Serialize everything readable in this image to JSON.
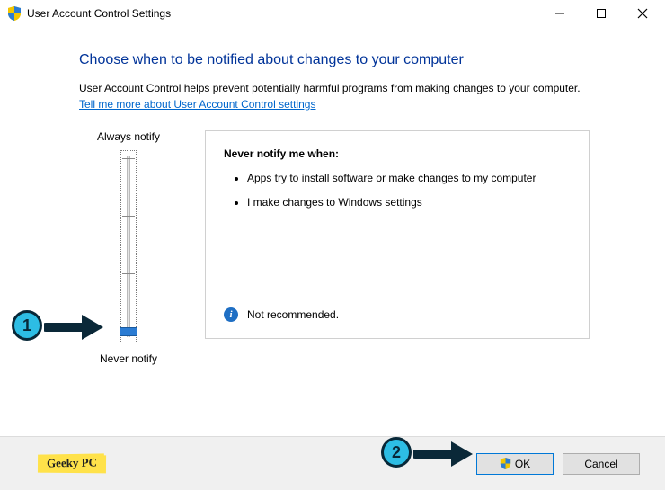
{
  "window": {
    "title": "User Account Control Settings"
  },
  "heading": "Choose when to be notified about changes to your computer",
  "subtext": "User Account Control helps prevent potentially harmful programs from making changes to your computer.",
  "helplink": "Tell me more about User Account Control settings",
  "slider": {
    "top_label": "Always notify",
    "bottom_label": "Never notify"
  },
  "panel": {
    "title": "Never notify me when:",
    "bullets": [
      "Apps try to install software or make changes to my computer",
      "I make changes to Windows settings"
    ],
    "recommendation": "Not recommended."
  },
  "buttons": {
    "ok": "OK",
    "cancel": "Cancel"
  },
  "annotations": {
    "step1": "1",
    "step2": "2"
  },
  "watermark": "Geeky PC"
}
